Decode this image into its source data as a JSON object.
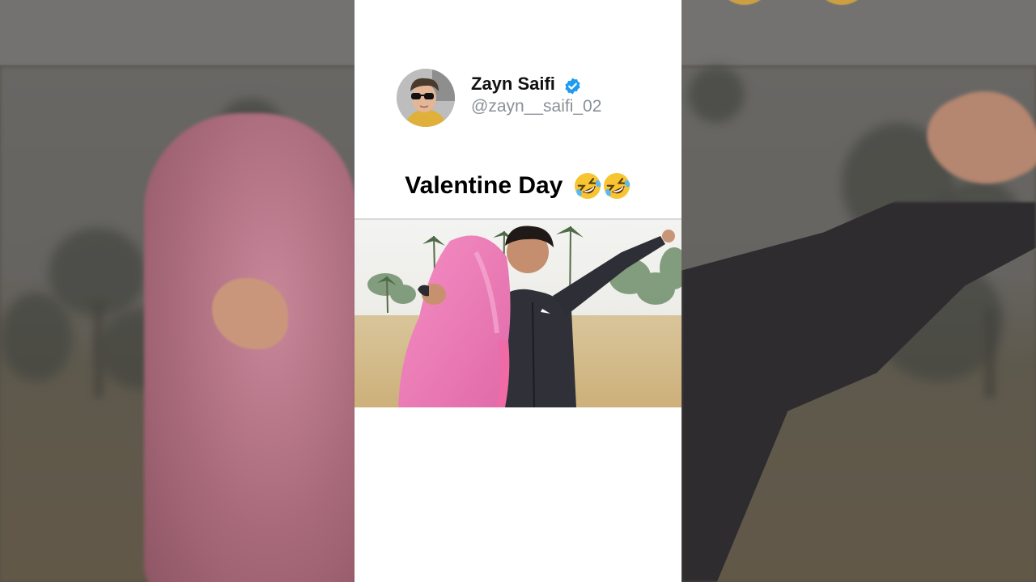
{
  "post": {
    "author_name": "Zayn Saifi",
    "author_handle": "@zayn__saifi_02",
    "verified": true,
    "caption": "Valentine Day",
    "caption_emoji": "rolling-on-the-floor-laughing",
    "caption_emoji_count": 2
  },
  "colors": {
    "card_background": "#ffffff",
    "verified_badge": "#1d9bf0",
    "handle_text": "#8a9097",
    "backdrop": "#5f5a52"
  },
  "icons": {
    "verified": "verified-badge-icon",
    "emoji": "laughing-emoji-icon"
  }
}
